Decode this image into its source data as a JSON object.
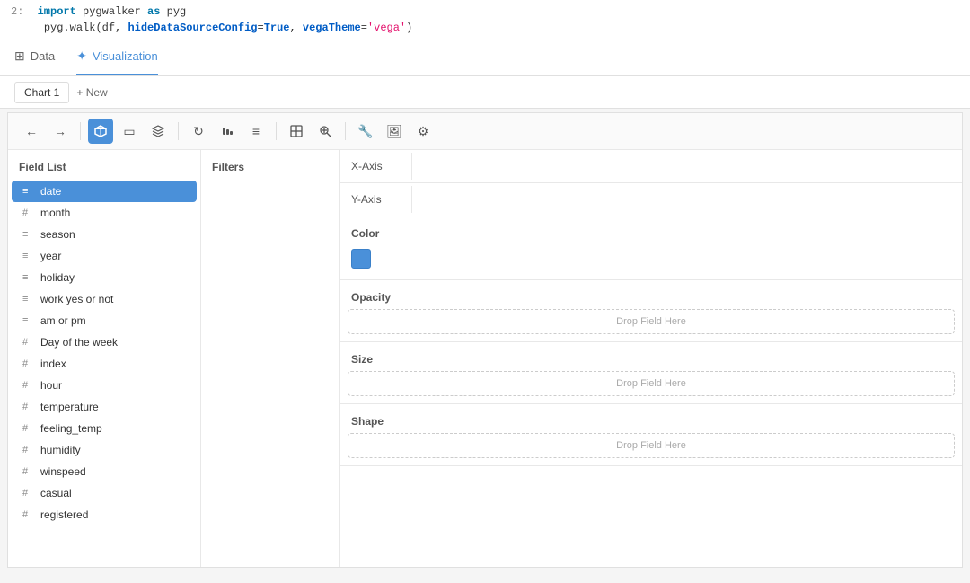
{
  "code": {
    "line_num": "2:",
    "line1": "import pygwalker as pyg",
    "line2_prefix": "pyg.walk(df, hideDataSourceConfig=",
    "line2_true": "True",
    "line2_suffix": ", vegaTheme=",
    "line2_theme": "'vega'",
    "line2_end": ")"
  },
  "tabs": {
    "data_label": "Data",
    "viz_label": "Visualization"
  },
  "chart_tabs": {
    "chart1_label": "Chart 1",
    "new_label": "+ New"
  },
  "toolbar": {
    "undo_label": "←",
    "redo_label": "→",
    "chart_icon": "⬡",
    "mark_icon": "◻",
    "layer_icon": "⊞",
    "refresh_icon": "↻",
    "sort_asc_icon": "↑",
    "sort_desc_icon": "≡",
    "zoom_icon": "⤢",
    "zoom_in_icon": "⊕",
    "link_icon": "🔗",
    "wrench_icon": "🔧",
    "image_icon": "🖼",
    "gear_icon": "⚙"
  },
  "field_list": {
    "title": "Field List",
    "fields": [
      {
        "name": "date",
        "type": "doc",
        "active": true
      },
      {
        "name": "month",
        "type": "hash"
      },
      {
        "name": "season",
        "type": "doc"
      },
      {
        "name": "year",
        "type": "doc"
      },
      {
        "name": "holiday",
        "type": "doc"
      },
      {
        "name": "work yes or not",
        "type": "doc"
      },
      {
        "name": "am or pm",
        "type": "doc"
      },
      {
        "name": "Day of the week",
        "type": "hash"
      },
      {
        "name": "index",
        "type": "hash"
      },
      {
        "name": "hour",
        "type": "hash"
      },
      {
        "name": "temperature",
        "type": "hash"
      },
      {
        "name": "feeling_temp",
        "type": "hash"
      },
      {
        "name": "humidity",
        "type": "hash"
      },
      {
        "name": "winspeed",
        "type": "hash"
      },
      {
        "name": "casual",
        "type": "hash"
      },
      {
        "name": "registered",
        "type": "hash"
      }
    ]
  },
  "filters": {
    "title": "Filters"
  },
  "encoding": {
    "x_axis_label": "X-Axis",
    "y_axis_label": "Y-Axis",
    "color_label": "Color",
    "opacity_label": "Opacity",
    "size_label": "Size",
    "shape_label": "Shape",
    "drop_field_here": "Drop Field Here"
  }
}
